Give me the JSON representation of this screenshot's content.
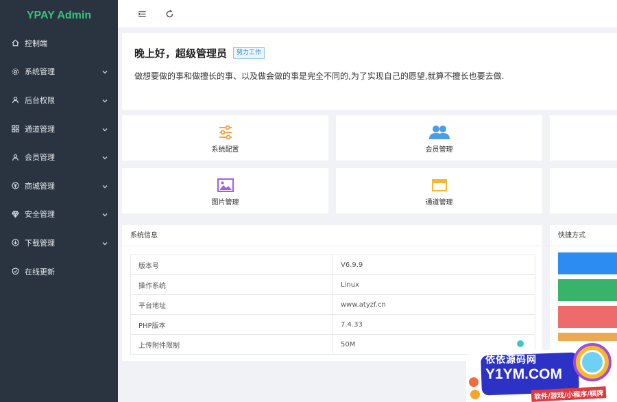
{
  "sidebar": {
    "logo": "YPAY Admin",
    "items": [
      {
        "label": "控制端",
        "icon": "home-icon",
        "has_arrow": false
      },
      {
        "label": "系统管理",
        "icon": "gear-icon",
        "has_arrow": true
      },
      {
        "label": "后台权限",
        "icon": "user-icon",
        "has_arrow": true
      },
      {
        "label": "通道管理",
        "icon": "apps-icon",
        "has_arrow": true
      },
      {
        "label": "会员管理",
        "icon": "user-icon",
        "has_arrow": true
      },
      {
        "label": "商城管理",
        "icon": "yen-icon",
        "has_arrow": true
      },
      {
        "label": "安全管理",
        "icon": "diamond-icon",
        "has_arrow": true
      },
      {
        "label": "下载管理",
        "icon": "download-icon",
        "has_arrow": true
      },
      {
        "label": "在线更新",
        "icon": "shield-icon",
        "has_arrow": false
      }
    ]
  },
  "topbar": {
    "menu_toggle_icon": "menu-fold-icon",
    "refresh_icon": "refresh-icon"
  },
  "welcome": {
    "greeting": "晚上好，超级管理员",
    "badge": "努力工作",
    "motto": "做想要做的事和做擅长的事、以及做会做的事是完全不同的,为了实现自己的愿望,就算不擅长也要去做."
  },
  "tiles": [
    {
      "label": "系统配置",
      "icon": "sliders-icon",
      "color": "#f5a24a"
    },
    {
      "label": "会员管理",
      "icon": "users-icon",
      "color": "#4a9ee8"
    },
    {
      "label": "图片管理",
      "icon": "image-icon",
      "color": "#a25de6"
    },
    {
      "label": "通道管理",
      "icon": "window-icon",
      "color": "#f5b82e"
    }
  ],
  "system_info": {
    "title": "系统信息",
    "rows": [
      {
        "key": "版本号",
        "value": "V6.9.9"
      },
      {
        "key": "操作系统",
        "value": "Linux"
      },
      {
        "key": "平台地址",
        "value": "www.atyzf.cn"
      },
      {
        "key": "PHP版本",
        "value": "7.4.33"
      },
      {
        "key": "上传附件限制",
        "value": "50M"
      }
    ]
  },
  "quick": {
    "title": "快捷方式",
    "buttons": [
      {
        "color": "#2d8cf0"
      },
      {
        "color": "#37b36a"
      },
      {
        "color": "#ef6b6b"
      },
      {
        "color": "#f0a953"
      }
    ]
  },
  "watermark": {
    "line1": "依依源码网",
    "line2": "Y1YM.COM",
    "line3": "软件/游戏/小程序/棋牌"
  }
}
